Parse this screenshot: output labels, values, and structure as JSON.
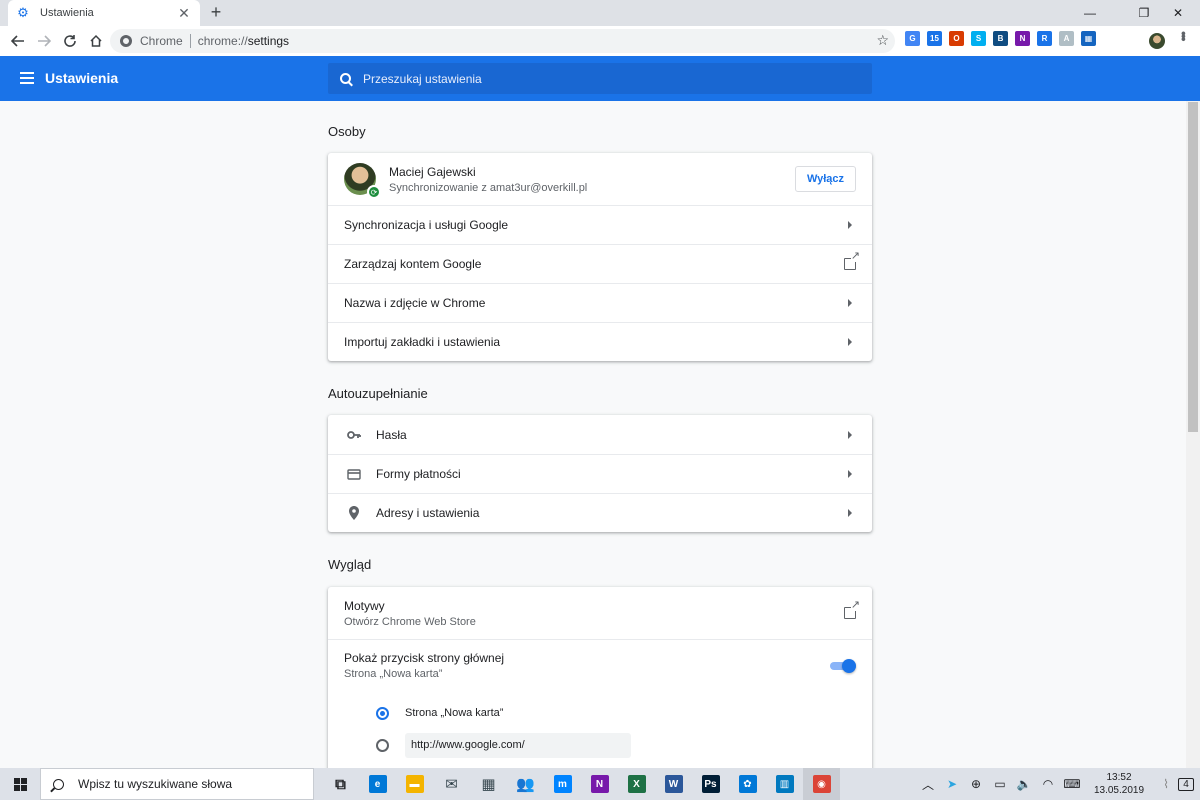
{
  "tab": {
    "title": "Ustawienia",
    "close": "✕",
    "new_tab": "+"
  },
  "window": {
    "minimize": "—",
    "restore": "❐",
    "close": "✕"
  },
  "toolbar": {
    "origin_label": "Chrome",
    "url_scheme": "chrome://",
    "url_path": "settings",
    "extensions": [
      {
        "name": "google-translate-icon",
        "color": "#4285f4",
        "glyph": "G"
      },
      {
        "name": "calendar-badge-icon",
        "color": "#1a73e8",
        "glyph": "15"
      },
      {
        "name": "office-icon",
        "color": "#d83b01",
        "glyph": "O"
      },
      {
        "name": "skype-icon",
        "color": "#00aff0",
        "glyph": "S"
      },
      {
        "name": "shopping-bag-icon",
        "color": "#0f4c81",
        "glyph": "B"
      },
      {
        "name": "onenote-icon",
        "color": "#7719aa",
        "glyph": "N"
      },
      {
        "name": "window-resizer-icon",
        "color": "#1a73e8",
        "glyph": "R"
      },
      {
        "name": "pdf-icon",
        "color": "#b0bec5",
        "glyph": "A"
      },
      {
        "name": "grid-icon",
        "color": "#1565c0",
        "glyph": "▦"
      }
    ]
  },
  "header": {
    "title": "Ustawienia",
    "search_placeholder": "Przeszukaj ustawienia"
  },
  "people": {
    "title": "Osoby",
    "name": "Maciej Gajewski",
    "email": "Synchronizowanie z amat3ur@overkill.pl",
    "turn_off": "Wyłącz",
    "rows": [
      {
        "label": "Synchronizacja i usługi Google"
      },
      {
        "label": "Zarządzaj kontem Google"
      },
      {
        "label": "Nazwa i zdjęcie w Chrome"
      },
      {
        "label": "Importuj zakładki i ustawienia"
      }
    ]
  },
  "autofill": {
    "title": "Autouzupełnianie",
    "rows": [
      {
        "label": "Hasła",
        "icon": "key-icon"
      },
      {
        "label": "Formy płatności",
        "icon": "credit-card-icon"
      },
      {
        "label": "Adresy i ustawienia",
        "icon": "location-pin-icon"
      }
    ]
  },
  "appearance": {
    "title": "Wygląd",
    "themes_label": "Motywy",
    "themes_sub": "Otwórz Chrome Web Store",
    "home_label": "Pokaż przycisk strony głównej",
    "home_sub": "Strona „Nowa karta”",
    "home_enabled": true,
    "radio_newtab": "Strona „Nowa karta”",
    "radio_custom_value": "http://www.google.com/"
  },
  "taskbar": {
    "search_placeholder": "Wpisz tu wyszukiwane słowa",
    "time": "13:52",
    "date": "13.05.2019",
    "notifications": "4",
    "apps": [
      {
        "name": "task-view-icon",
        "color": "#202124",
        "glyph": "⧉"
      },
      {
        "name": "edge-icon",
        "color": "#0078d7",
        "glyph": "e"
      },
      {
        "name": "file-explorer-icon",
        "color": "#f4b400",
        "glyph": "▬"
      },
      {
        "name": "mail-icon",
        "color": "#37474f",
        "glyph": "✉"
      },
      {
        "name": "calendar-icon",
        "color": "#37474f",
        "glyph": "▦"
      },
      {
        "name": "people-icon",
        "color": "#37474f",
        "glyph": "👥"
      },
      {
        "name": "messenger-icon",
        "color": "#0084ff",
        "glyph": "m"
      },
      {
        "name": "onenote-app-icon",
        "color": "#7719aa",
        "glyph": "N"
      },
      {
        "name": "excel-app-icon",
        "color": "#1e7145",
        "glyph": "X"
      },
      {
        "name": "word-app-icon",
        "color": "#2b579a",
        "glyph": "W"
      },
      {
        "name": "photoshop-icon",
        "color": "#001e36",
        "glyph": "Ps"
      },
      {
        "name": "photo-app-icon",
        "color": "#0078d7",
        "glyph": "✿"
      },
      {
        "name": "trello-icon",
        "color": "#0079bf",
        "glyph": "▥"
      },
      {
        "name": "chrome-app-icon",
        "color": "#db4437",
        "glyph": "◉"
      }
    ]
  }
}
